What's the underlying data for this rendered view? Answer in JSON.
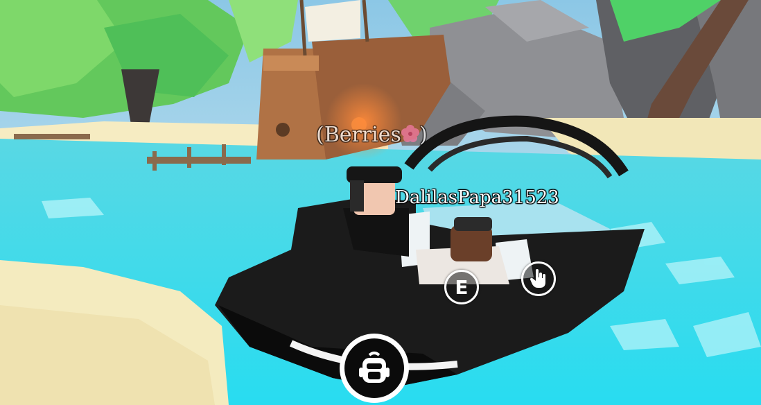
{
  "nametags": {
    "pet": "(Berries",
    "pet_close": ")",
    "player": "DalilasPapa31523"
  },
  "buttons": {
    "interact_key": "E"
  },
  "icons": {
    "hand": "hand-pointer-icon",
    "backpack": "backpack-icon",
    "flower": "hibiscus-flower-icon"
  },
  "colors": {
    "water": "#35d8ea",
    "sand": "#f3e6b5",
    "boat": "#141414",
    "foliage": "#5fd35a"
  }
}
